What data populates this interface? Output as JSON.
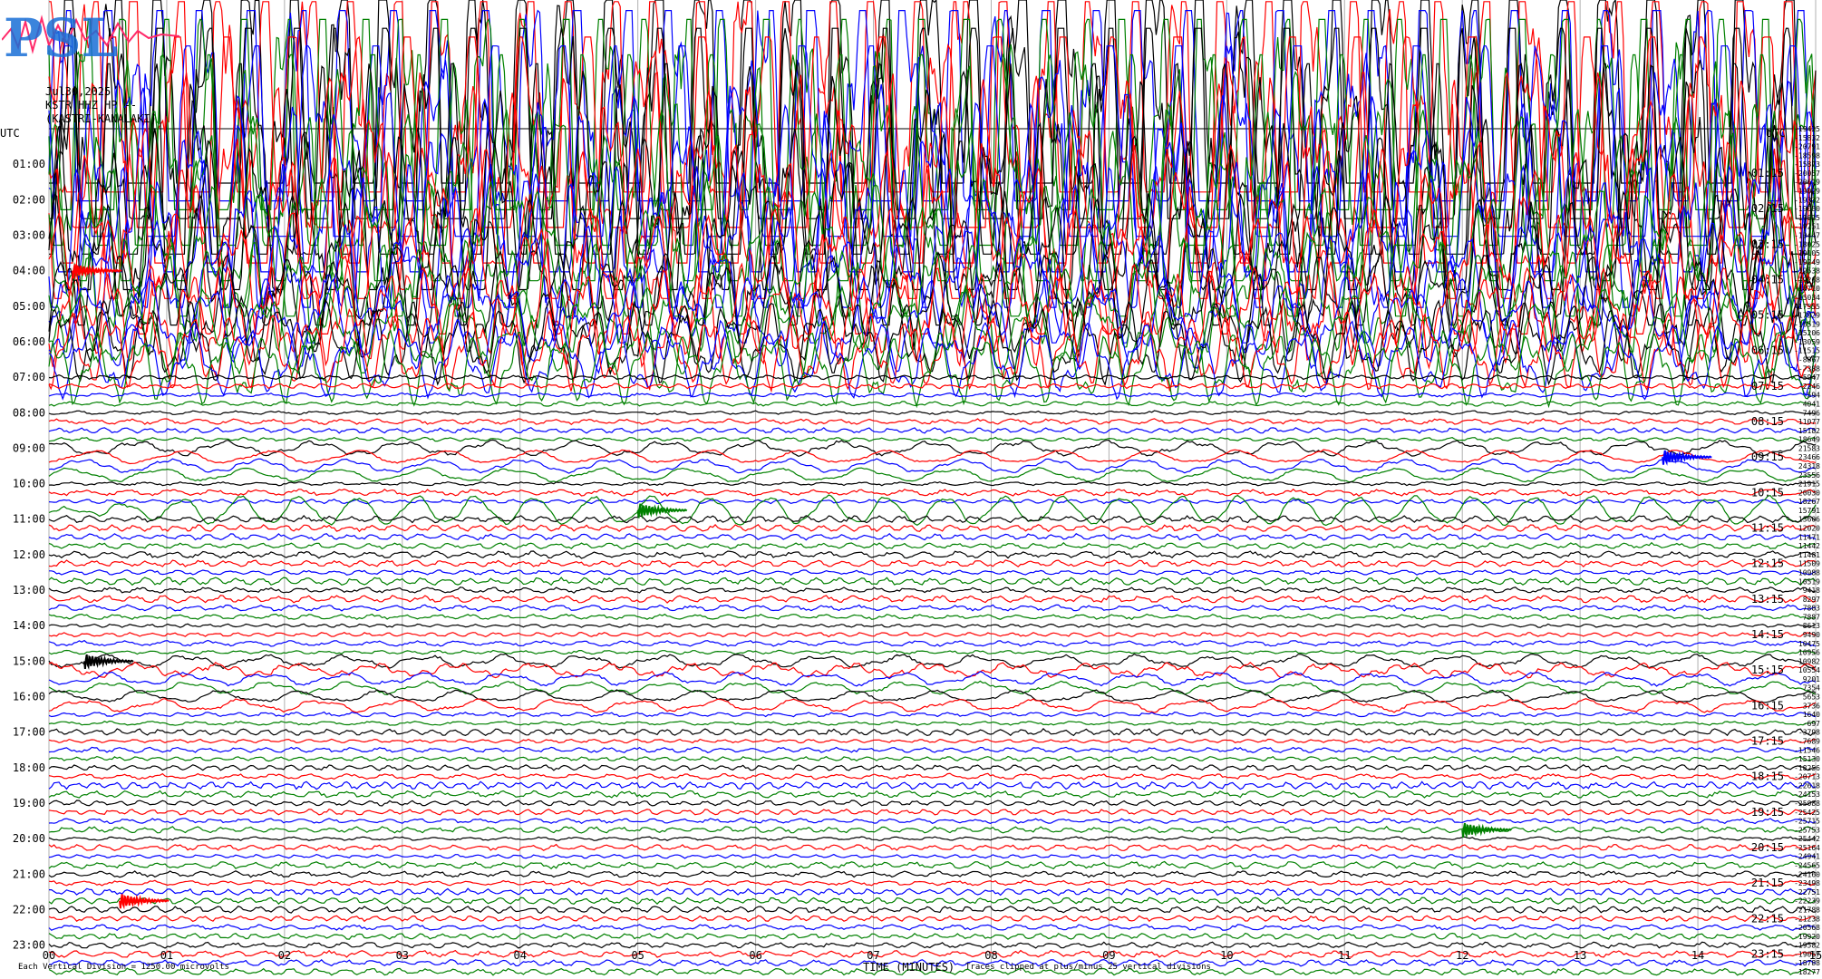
{
  "header": {
    "date": "Jul30,2025",
    "station": "KSTR HHZ HP --",
    "location": "(KASTRI-KANALAKI)",
    "utc_label": "UTC"
  },
  "logo": {
    "text": "PSL"
  },
  "footer": {
    "scale_note": "Each Vertical Division = 1250.00 microvolts",
    "xaxis_title": "TIME (MINUTES)",
    "clip_note": "Traces clipped at plus/minus 25 vertical divisions"
  },
  "chart_data": {
    "type": "line",
    "title": "",
    "xlabel": "TIME (MINUTES)",
    "xlim": [
      0,
      15
    ],
    "x_ticks": [
      "00",
      "01",
      "02",
      "03",
      "04",
      "05",
      "06",
      "07",
      "08",
      "09",
      "10",
      "11",
      "12",
      "13",
      "14",
      "15"
    ],
    "left_hour_labels": [
      "01:00",
      "02:00",
      "03:00",
      "04:00",
      "05:00",
      "06:00",
      "07:00",
      "08:00",
      "09:00",
      "10:00",
      "11:00",
      "12:00",
      "13:00",
      "14:00",
      "15:00",
      "16:00",
      "17:00",
      "18:00",
      "19:00",
      "20:00",
      "21:00",
      "22:00",
      "23:00"
    ],
    "right_hour_labels": [
      "01:15",
      "02:15",
      "03:15",
      "04:15",
      "05:15",
      "06:15",
      "07:15",
      "08:15",
      "09:15",
      "10:15",
      "11:15",
      "12:15",
      "13:15",
      "14:15",
      "15:15",
      "16:15",
      "17:15",
      "18:15",
      "19:15",
      "20:15",
      "21:15",
      "22:15",
      "23:15"
    ],
    "trace_colors": [
      "#000000",
      "#ff0000",
      "#0000ff",
      "#008000"
    ],
    "trace_count": 96,
    "trace_offsets": [
      "-19425",
      "-15832",
      "-20791",
      "-18598",
      "-15873",
      "-20057",
      "-20619",
      "-19029",
      "-19332",
      "-19080",
      "-19625",
      "-19251",
      "-10447",
      "-18025",
      "-19105",
      "-19249",
      "-19538",
      "-19268",
      "-18710",
      "-15034",
      "-17555",
      "-17929",
      "-16519",
      "-15206",
      "-13059",
      "-11515",
      "-8867",
      "-7388",
      "-5947",
      "-2246",
      "594",
      "4041",
      "7496",
      "11077",
      "15182",
      "18649",
      "21583",
      "23466",
      "24318",
      "23556",
      "21915",
      "20030",
      "18267",
      "15791",
      "13606",
      "12020",
      "11471",
      "11442",
      "11481",
      "11509",
      "10988",
      "10519",
      "9418",
      "8297",
      "7883",
      "7887",
      "8613",
      "9490",
      "10475",
      "10956",
      "10982",
      "10554",
      "9201",
      "7354",
      "5653",
      "3736",
      "1640",
      "-697",
      "-3798",
      "-7689",
      "-11546",
      "-15130",
      "-18256",
      "-20713",
      "-22618",
      "-24153",
      "-25088",
      "-25425",
      "-25715",
      "-25753",
      "-25442",
      "-25164",
      "-24941",
      "-24565",
      "-24160",
      "-23498",
      "-22751",
      "-22239",
      "-21788",
      "-21238",
      "-20568",
      "-19920",
      "-19582",
      "-19067",
      "-18788",
      "-18277"
    ],
    "clip_divisions": 25,
    "division_microvolts": 1250.0,
    "clipped_hours": [
      "00:00",
      "01:00",
      "02:00",
      "03:00",
      "04:00",
      "05:00",
      "06:00"
    ],
    "events": [
      {
        "hour": "04:00",
        "minute": 0.2,
        "color": "red",
        "note": "burst"
      },
      {
        "hour": "09:15",
        "minute": 13.7,
        "color": "blue",
        "note": "spike"
      },
      {
        "hour": "10:45",
        "minute": 5.0,
        "color": "green",
        "note": "oscillation"
      },
      {
        "hour": "15:00",
        "minute": 0.3,
        "color": "black",
        "note": "burst"
      },
      {
        "hour": "19:45",
        "minute": 12.0,
        "color": "green",
        "note": "burst"
      },
      {
        "hour": "21:45",
        "minute": 0.6,
        "color": "red",
        "note": "burst"
      }
    ]
  }
}
